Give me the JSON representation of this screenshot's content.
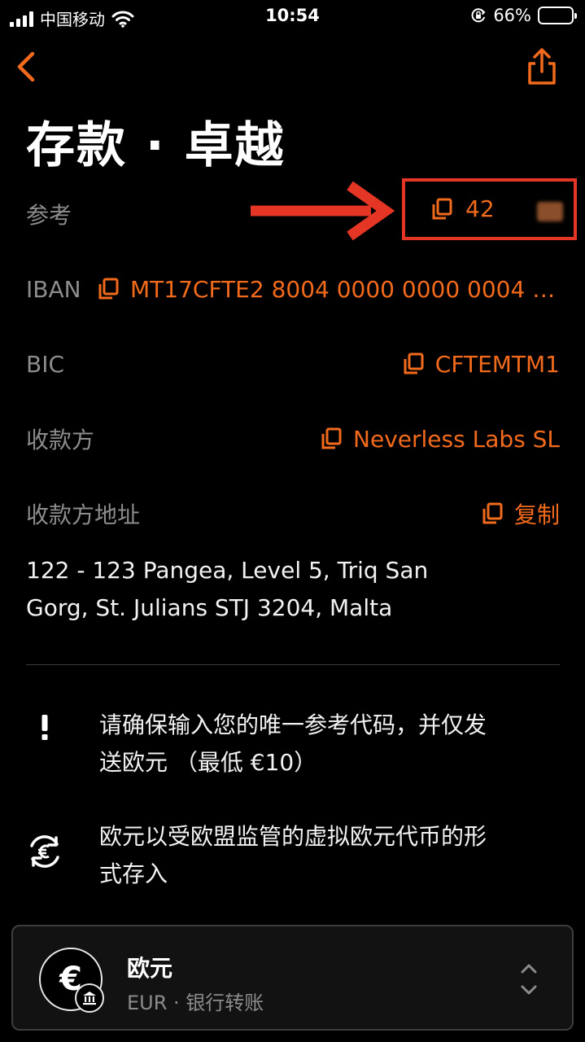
{
  "status": {
    "carrier": "中国移动",
    "time": "10:54",
    "battery": "66%",
    "battery_level": 0.66
  },
  "header": {
    "title": "存款 · 卓越"
  },
  "fields": {
    "reference": {
      "label": "参考",
      "value": "42"
    },
    "iban": {
      "label": "IBAN",
      "value": "MT17CFTE2 8004 0000 0000 0004 4…"
    },
    "bic": {
      "label": "BIC",
      "value": "CFTEMTM1"
    },
    "payee": {
      "label": "收款方",
      "value": "Neverless Labs SL"
    },
    "payee_address": {
      "label": "收款方地址",
      "copy_label": "复制"
    }
  },
  "address": {
    "line1": "122 - 123 Pangea, Level 5, Triq San",
    "line2": "Gorg, St. Julians STJ 3204, Malta"
  },
  "notices": {
    "warning": {
      "line1": "请确保输入您的唯一参考代码，并仅发",
      "line2": "送欧元 （最低 €10）"
    },
    "euro": {
      "line1": "欧元以受欧盟监管的虚拟欧元代币的形",
      "line2": "式存入"
    }
  },
  "currency": {
    "symbol": "€",
    "name": "欧元",
    "subtitle": "EUR · 银行转账"
  },
  "colors": {
    "accent": "#f26a1b",
    "highlight": "#e53525",
    "label_gray": "#8c8c8c",
    "background": "#000000"
  }
}
